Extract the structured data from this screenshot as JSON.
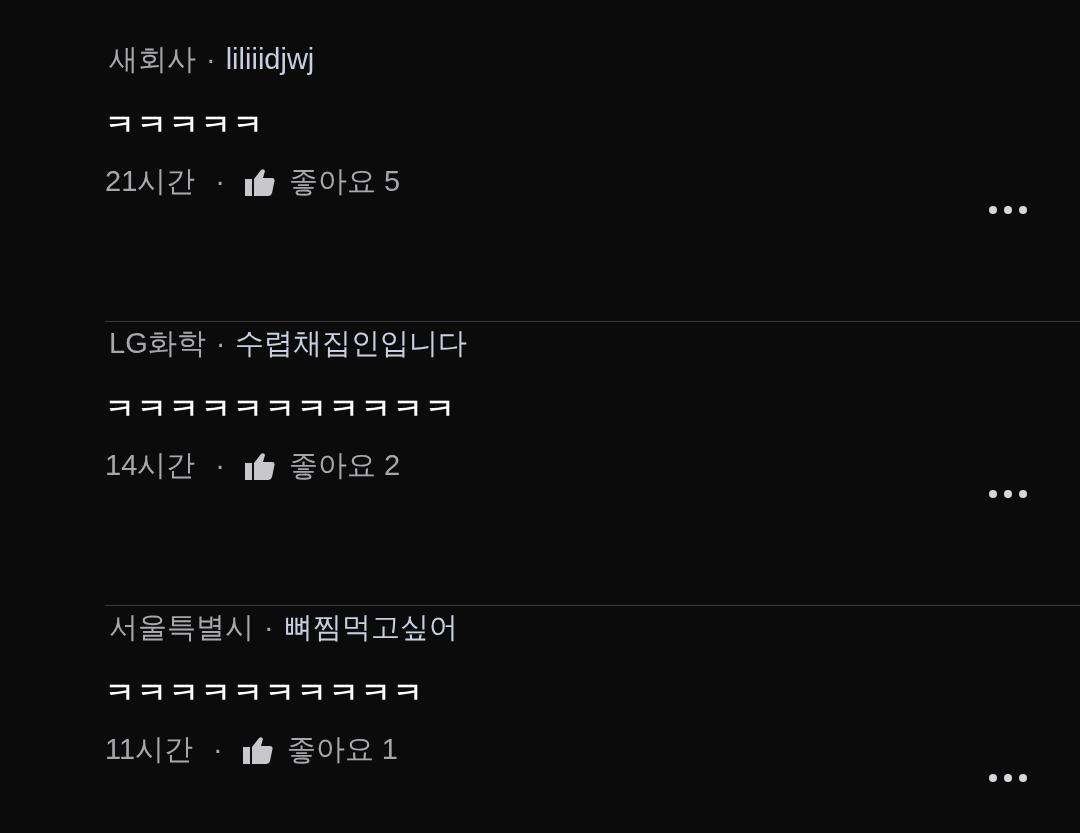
{
  "comments": [
    {
      "region": "새회사",
      "separator": "·",
      "nickname": "liliiidjwj",
      "text": "ㅋㅋㅋㅋㅋ",
      "time": "21시간",
      "meta_separator": "·",
      "likes": "좋아요 5"
    },
    {
      "region": "LG화학",
      "separator": "·",
      "nickname": "수렵채집인입니다",
      "text": "ㅋㅋㅋㅋㅋㅋㅋㅋㅋㅋㅋ",
      "time": "14시간",
      "meta_separator": "·",
      "likes": "좋아요 2"
    },
    {
      "region": "서울특별시",
      "separator": "·",
      "nickname": "뼈찜먹고싶어",
      "text": "ㅋㅋㅋㅋㅋㅋㅋㅋㅋㅋ",
      "time": "11시간",
      "meta_separator": "·",
      "likes": "좋아요 1"
    }
  ]
}
